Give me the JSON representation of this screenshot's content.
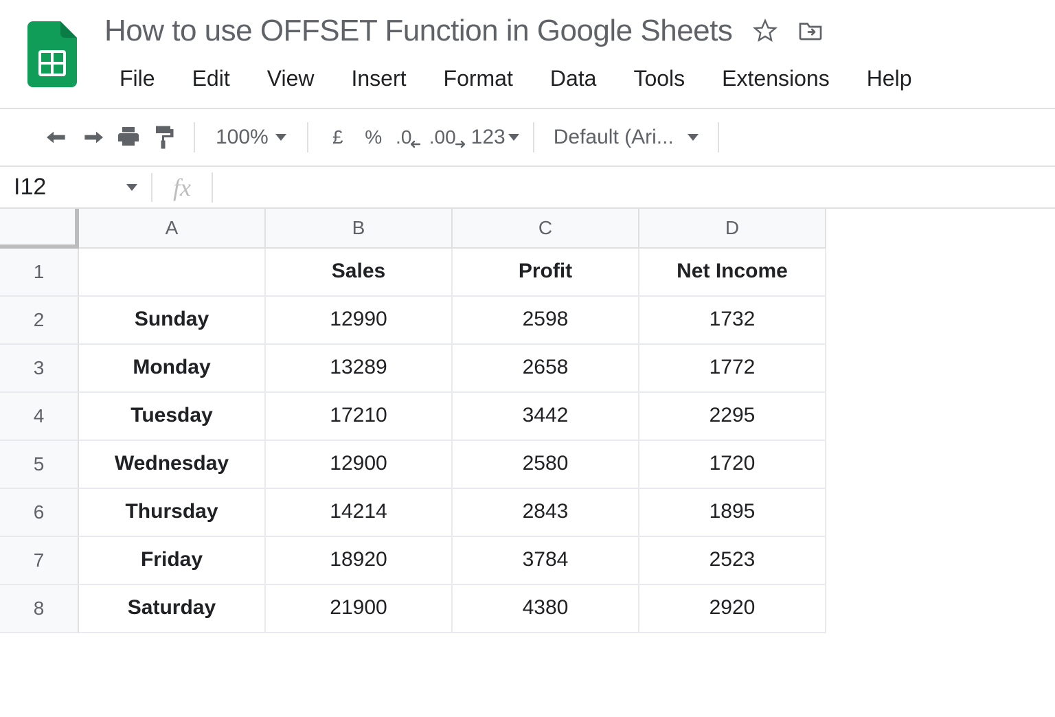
{
  "doc_title": "How to use OFFSET Function in Google Sheets",
  "menu": [
    "File",
    "Edit",
    "View",
    "Insert",
    "Format",
    "Data",
    "Tools",
    "Extensions",
    "Help"
  ],
  "toolbar": {
    "zoom": "100%",
    "currency": "£",
    "percent": "%",
    "dec_dec": ".0",
    "inc_dec": ".00",
    "fmt_more": "123",
    "font": "Default (Ari..."
  },
  "name_box": "I12",
  "columns": [
    "A",
    "B",
    "C",
    "D"
  ],
  "row_numbers": [
    "1",
    "2",
    "3",
    "4",
    "5",
    "6",
    "7",
    "8"
  ],
  "table": {
    "headers": [
      "",
      "Sales",
      "Profit",
      "Net Income"
    ],
    "rows": [
      {
        "label": "Sunday",
        "sales": "12990",
        "profit": "2598",
        "net": "1732"
      },
      {
        "label": "Monday",
        "sales": "13289",
        "profit": "2658",
        "net": "1772"
      },
      {
        "label": "Tuesday",
        "sales": "17210",
        "profit": "3442",
        "net": "2295"
      },
      {
        "label": "Wednesday",
        "sales": "12900",
        "profit": "2580",
        "net": "1720"
      },
      {
        "label": "Thursday",
        "sales": "14214",
        "profit": "2843",
        "net": "1895"
      },
      {
        "label": "Friday",
        "sales": "18920",
        "profit": "3784",
        "net": "2523"
      },
      {
        "label": "Saturday",
        "sales": "21900",
        "profit": "4380",
        "net": "2920"
      }
    ]
  }
}
